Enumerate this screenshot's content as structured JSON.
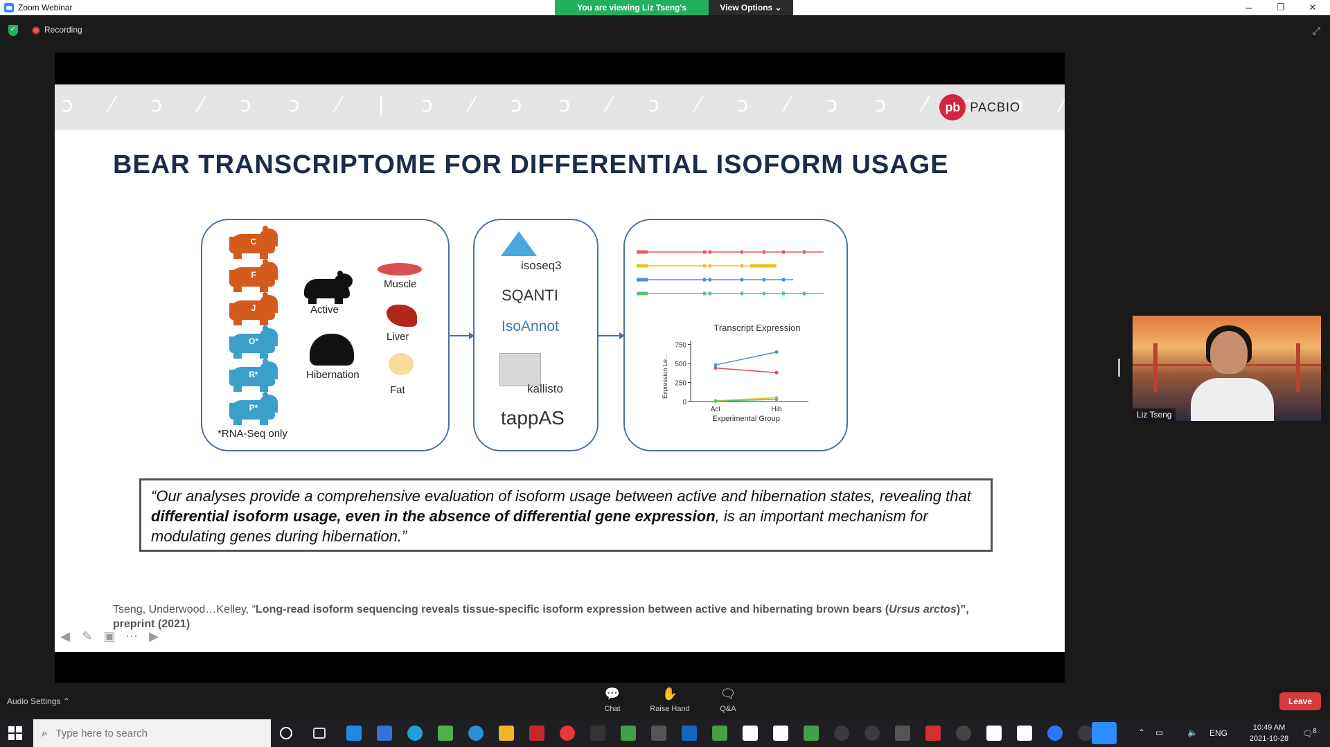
{
  "window": {
    "title": "Zoom Webinar",
    "viewing_banner": "You are viewing Liz Tseng's screen",
    "view_options": "View Options",
    "minimize": "─",
    "restore": "❐",
    "close": "✕"
  },
  "meeting": {
    "recording_label": "Recording"
  },
  "slide": {
    "logo_text": "PACBIO",
    "title": "BEAR TRANSCRIPTOME FOR DIFFERENTIAL ISOFORM USAGE",
    "bears": [
      "C",
      "F",
      "J",
      "O*",
      "R*",
      "P*"
    ],
    "rna_seq_note": "*RNA-Seq only",
    "states": [
      "Active",
      "Hibernation"
    ],
    "tissues": [
      "Muscle",
      "Liver",
      "Fat"
    ],
    "tools": [
      "isoseq3",
      "SQANTI",
      "IsoAnnot",
      "kallisto",
      "tappAS"
    ],
    "quote_part1": "“Our analyses provide a comprehensive evaluation of isoform usage between active and hibernation states, revealing that ",
    "quote_bold": "differential isoform usage, even in the absence of differential gene expression",
    "quote_part2": ", is an important mechanism for modulating genes during hibernation.”",
    "citation_authors": "Tseng, Underwood…Kelley, “",
    "citation_title": "Long-read isoform sequencing reveals tissue-specific isoform expression between active and hibernating brown bears (",
    "citation_species": "Ursus arctos",
    "citation_tail": ")”, preprint (2021)"
  },
  "chart_data": {
    "type": "line",
    "title": "Transcript Expression",
    "xlabel": "Experimental Group",
    "ylabel": "Expression Le...",
    "categories": [
      "Act",
      "Hib"
    ],
    "yticks": [
      0,
      250,
      500,
      750
    ],
    "ylim": [
      0,
      800
    ],
    "series": [
      {
        "color": "#4a90d9",
        "values": [
          480,
          650
        ]
      },
      {
        "color": "#d94a5a",
        "values": [
          440,
          380
        ]
      },
      {
        "color": "#e0c030",
        "values": [
          10,
          50
        ]
      },
      {
        "color": "#5cc07a",
        "values": [
          5,
          30
        ]
      }
    ]
  },
  "isoform_tracks": [
    {
      "color": "#e85c5c"
    },
    {
      "color": "#f0c020"
    },
    {
      "color": "#4a90d9"
    },
    {
      "color": "#5cc07a"
    }
  ],
  "participant": {
    "name": "Liz Tseng"
  },
  "toolbar": {
    "audio_settings": "Audio Settings",
    "chat": "Chat",
    "raise_hand": "Raise Hand",
    "qa": "Q&A",
    "leave": "Leave"
  },
  "taskbar": {
    "search_placeholder": "Type here to search",
    "language": "ENG",
    "time": "10:49 AM",
    "date": "2021-10-28",
    "notification_count": "8"
  }
}
